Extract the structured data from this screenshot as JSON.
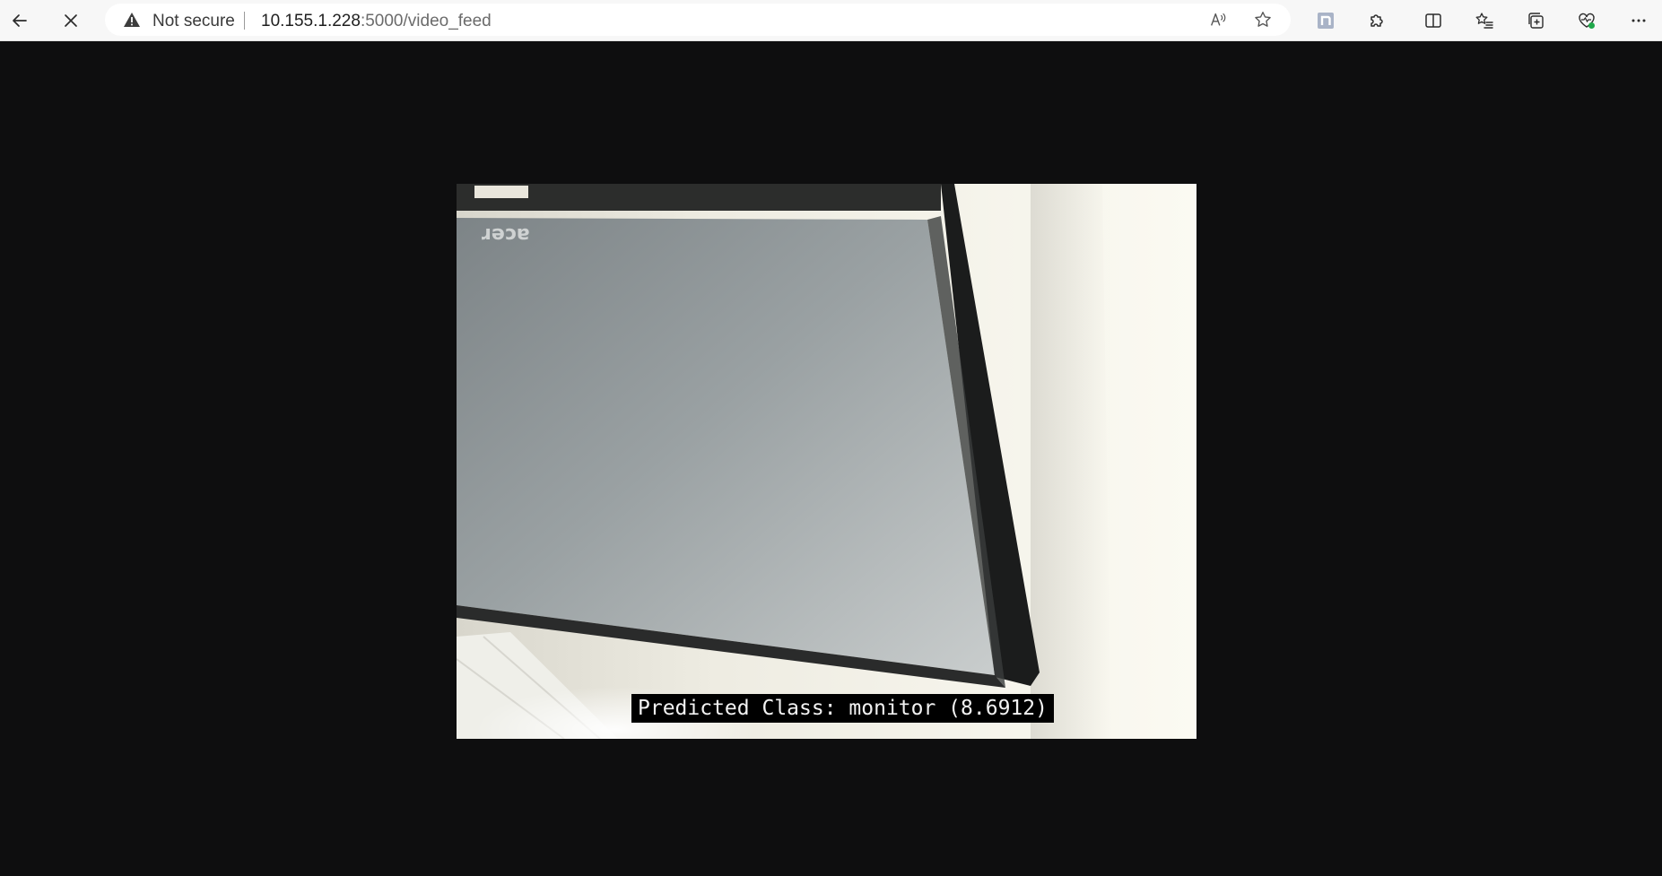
{
  "browser": {
    "security_label": "Not secure",
    "url_host": "10.155.1.228",
    "url_rest": ":5000/video_feed",
    "icons": [
      "back-arrow-icon",
      "close-icon",
      "warning-icon",
      "read-aloud-icon",
      "favorite-star-icon",
      "extension-n-icon",
      "extensions-puzzle-icon",
      "split-screen-icon",
      "favorites-list-icon",
      "collections-icon",
      "browser-essentials-icon",
      "more-menu-icon"
    ]
  },
  "video": {
    "caption": "Predicted Class: monitor (8.6912)",
    "brand_text": "acer"
  }
}
